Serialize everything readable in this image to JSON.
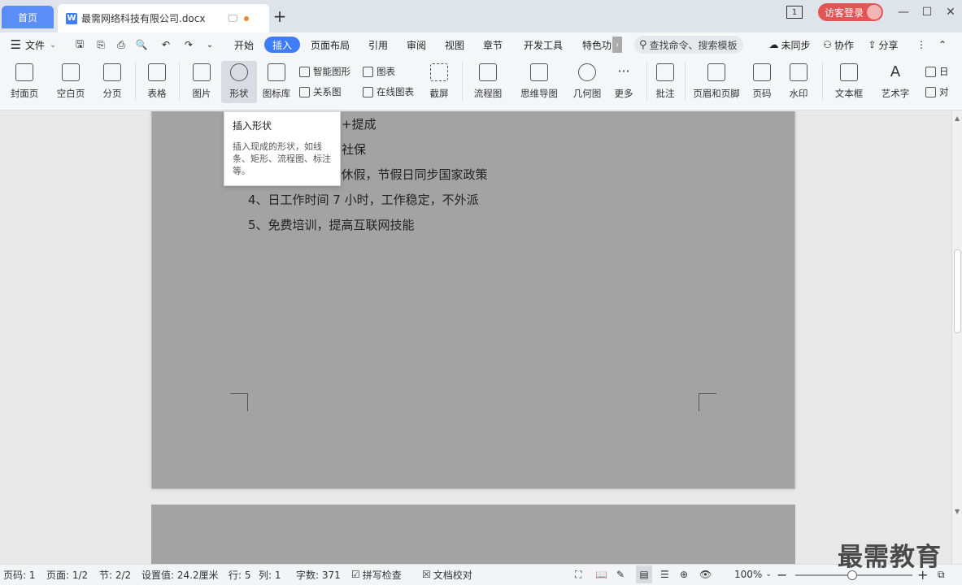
{
  "tabs": {
    "home_label": "首页",
    "doc_label": "最需网络科技有限公司.docx",
    "doc_icon": "W"
  },
  "titlebar": {
    "badge": "1",
    "login_label": "访客登录"
  },
  "menu": {
    "file_label": "文件",
    "items": [
      "开始",
      "插入",
      "页面布局",
      "引用",
      "审阅",
      "视图",
      "章节",
      "开发工具",
      "特色功"
    ],
    "search_placeholder": "查找命令、搜索模板",
    "sync_label": "未同步",
    "collab_label": "协作",
    "share_label": "分享"
  },
  "ribbon": {
    "cover_page": "封面页",
    "blank_page": "空白页",
    "page_break": "分页",
    "table": "表格",
    "picture": "图片",
    "shape": "形状",
    "icon_library": "图标库",
    "smart_art": "智能图形",
    "relation": "关系图",
    "chart": "图表",
    "online_chart": "在线图表",
    "screenshot": "截屏",
    "flowchart": "流程图",
    "mindmap": "思维导图",
    "geometry": "几何图",
    "more": "更多",
    "comment": "批注",
    "header_footer": "页眉和页脚",
    "page_number": "页码",
    "watermark": "水印",
    "textbox": "文本框",
    "wordart": "艺术字",
    "date_partial": "日",
    "object_partial": "对"
  },
  "tooltip": {
    "title": "插入形状",
    "desc": "插入现成的形状，如线条、矩形、流程图、标注等。"
  },
  "document": {
    "lines": [
      "+提成",
      "社保",
      "3、大小休，带薪休假，节假日同步国家政策",
      "4、日工作时间 7 小时，工作稳定，不外派",
      "5、免费培训，提高互联网技能"
    ]
  },
  "status": {
    "page_num": "页码: 1",
    "page_total": "页面: 1/2",
    "section": "节: 2/2",
    "setting": "设置值: 24.2厘米",
    "row": "行: 5",
    "col": "列: 1",
    "word_count": "字数: 371",
    "spell_check": "拼写检查",
    "doc_proof": "文档校对",
    "zoom": "100%"
  },
  "watermark_text": "最需教育"
}
